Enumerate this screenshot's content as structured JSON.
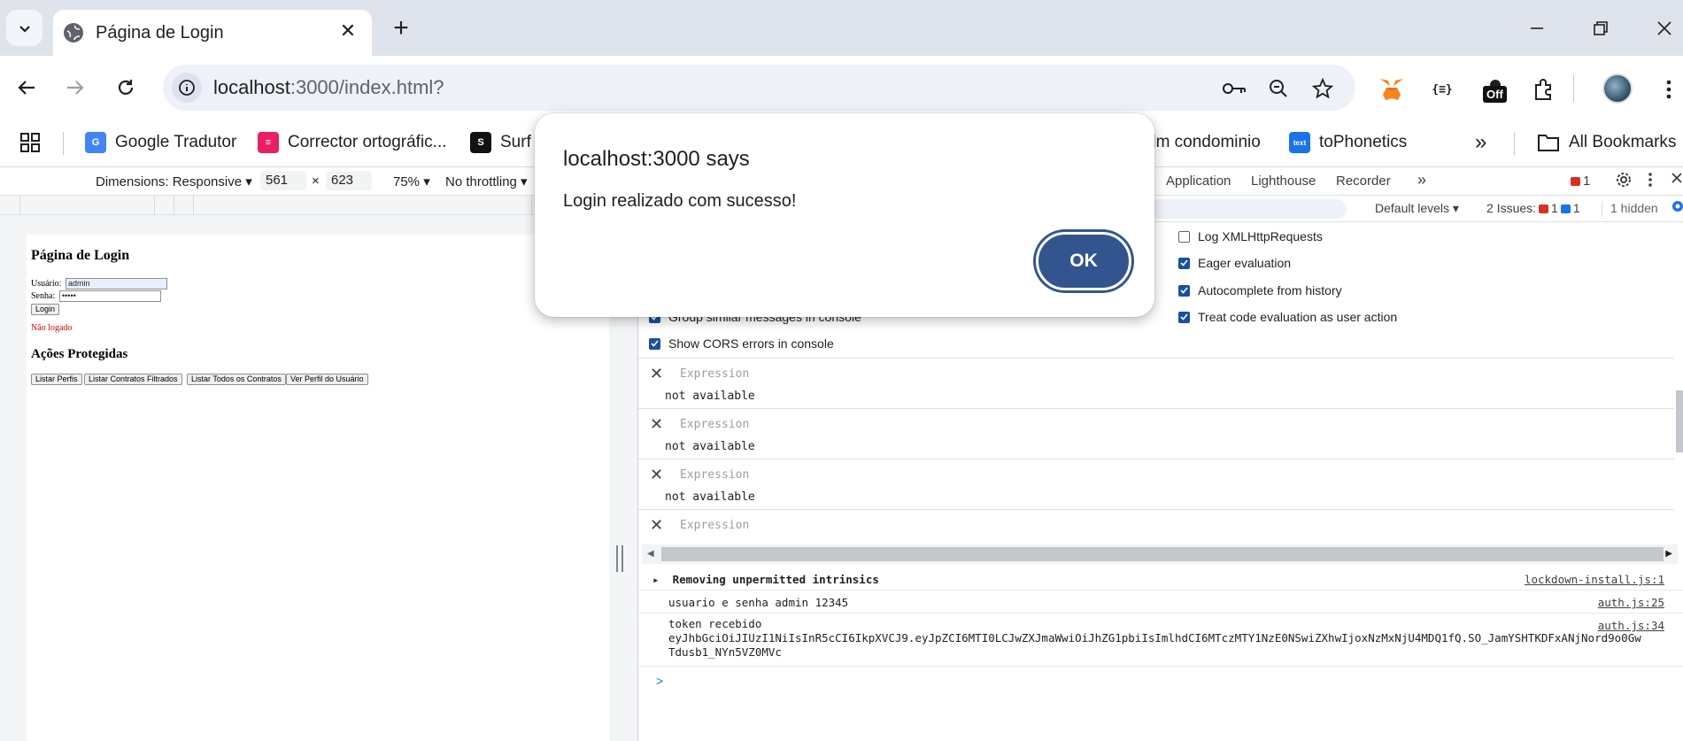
{
  "browser": {
    "tab": {
      "title": "Página de Login"
    },
    "url": {
      "host": "localhost",
      "rest": ":3000/index.html?"
    },
    "extensions": {
      "json_label": "{≡}",
      "off_badge": "Off"
    }
  },
  "bookmarks": {
    "items": [
      {
        "label": "Google Tradutor",
        "color": "#4285f4",
        "icon": "G"
      },
      {
        "label": "Corrector ortográfic...",
        "color": "#e91e63",
        "icon": "≡"
      },
      {
        "label": "Surf",
        "color": "#111111",
        "icon": "S"
      },
      {
        "label": "dm condominio",
        "color": "#ffffff",
        "icon": ""
      },
      {
        "label": "toPhonetics",
        "color": "#1a73e8",
        "icon": "text"
      }
    ],
    "all_label": "All Bookmarks",
    "overflow_label": "»"
  },
  "device_toolbar": {
    "dimensions_label": "Dimensions: Responsive ▾",
    "width": "561",
    "times": "×",
    "height": "623",
    "zoom": "75% ▾",
    "throttling": "No throttling ▾"
  },
  "emulated_page": {
    "title": "Página de Login",
    "user_label": "Usuário:",
    "user_value": "admin",
    "pass_label": "Senha:",
    "pass_value": "•••••",
    "login_button": "Login",
    "status": "Não logado",
    "protected_title": "Ações Protegidas",
    "buttons": [
      "Listar Perfis",
      "Listar Contratos Filtrados",
      "Listar Todos os Contratos",
      "Ver Perfil do Usuário"
    ]
  },
  "devtools": {
    "tabs": [
      "Application",
      "Lighthouse",
      "Recorder",
      "»"
    ],
    "error_count": "1",
    "default_levels": "Default levels ▾",
    "issues_label": "2 Issues:",
    "issues_err": "1",
    "issues_info": "1",
    "hidden": "1 hidden",
    "settings": [
      {
        "label": "Log XMLHttpRequests",
        "checked": false
      },
      {
        "label": "Eager evaluation",
        "checked": true
      },
      {
        "label": "Autocomplete from history",
        "checked": true
      },
      {
        "label": "Treat code evaluation as user action",
        "checked": true
      },
      {
        "label": "Group similar messages in console",
        "checked": true
      },
      {
        "label": "Show CORS errors in console",
        "checked": true
      }
    ],
    "expressions": [
      {
        "placeholder": "Expression",
        "value": "not available"
      },
      {
        "placeholder": "Expression",
        "value": "not available"
      },
      {
        "placeholder": "Expression",
        "value": "not available"
      },
      {
        "placeholder": "Expression",
        "value": ""
      }
    ],
    "console": [
      {
        "message": "▸  Removing unpermitted intrinsics",
        "source": "lockdown-install.js:1",
        "bold": true
      },
      {
        "message": "usuario e senha admin 12345",
        "source": "auth.js:25"
      },
      {
        "message": "token recebido\neyJhbGciOiJIUzI1NiIsInR5cCI6IkpXVCJ9.eyJpZCI6MTI0LCJwZXJmaWwiOiJhZG1pbiIsImlhdCI6MTczMTY1NzE0NSwiZXhwIjoxNzMxNjU4MDQ1fQ.SO_JamYSHTKDFxANjNord9o0Gw\nTdusb1_NYn5VZ0MVc",
        "source": "auth.js:34"
      }
    ],
    "prompt": ">"
  },
  "dialog": {
    "title": "localhost:3000 says",
    "message": "Login realizado com sucesso!",
    "ok": "OK"
  }
}
